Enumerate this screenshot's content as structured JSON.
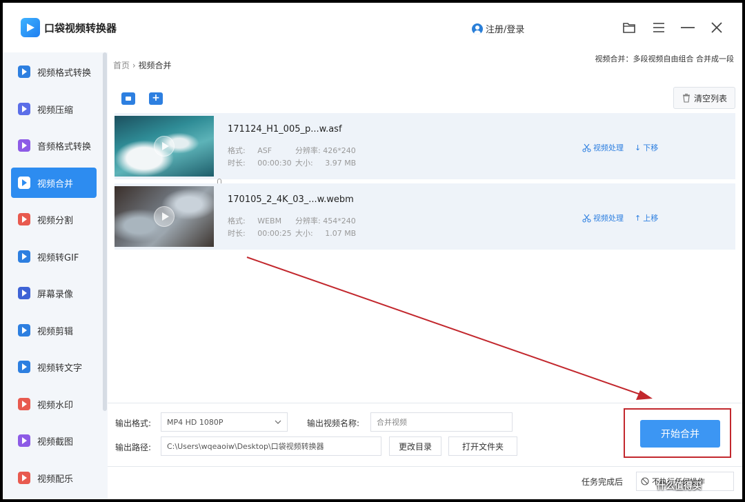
{
  "app": {
    "title": "口袋视频转换器",
    "login": "注册/登录"
  },
  "sidebar": {
    "items": [
      {
        "label": "视频格式转换",
        "color": "#2d7fe0"
      },
      {
        "label": "视频压缩",
        "color": "#5b6ee8"
      },
      {
        "label": "音频格式转换",
        "color": "#8d5be6"
      },
      {
        "label": "视频合并",
        "color": "#2d8cf0"
      },
      {
        "label": "视频分割",
        "color": "#e85a4f"
      },
      {
        "label": "视频转GIF",
        "color": "#2d7fe0"
      },
      {
        "label": "屏幕录像",
        "color": "#3e63d6"
      },
      {
        "label": "视频剪辑",
        "color": "#2d7fe0"
      },
      {
        "label": "视频转文字",
        "color": "#2d7fe0"
      },
      {
        "label": "视频水印",
        "color": "#e85a4f"
      },
      {
        "label": "视频截图",
        "color": "#8d5be6"
      },
      {
        "label": "视频配乐",
        "color": "#e85a4f"
      }
    ],
    "active_index": 3
  },
  "breadcrumb": {
    "home": "首页",
    "sep": "›",
    "current": "视频合并"
  },
  "hint": "视频合并：多段视频自由组合 合并成一段",
  "toolbar": {
    "clear_label": "清空列表"
  },
  "labels": {
    "format": "格式:",
    "resolution": "分辨率:",
    "duration": "时长:",
    "size": "大小:"
  },
  "videos": [
    {
      "name": "171124_H1_005_p...w.asf",
      "format": "ASF",
      "resolution": "426*240",
      "duration": "00:00:30",
      "size": "3.97 MB",
      "process": "视频处理",
      "move": "下移",
      "move_glyph": "↓"
    },
    {
      "name": "170105_2_4K_03_...w.webm",
      "format": "WEBM",
      "resolution": "454*240",
      "duration": "00:00:25",
      "size": "1.07 MB",
      "process": "视频处理",
      "move": "上移",
      "move_glyph": "↑"
    }
  ],
  "output": {
    "format_label": "输出格式:",
    "format_value": "MP4   HD 1080P",
    "name_label": "输出视频名称:",
    "name_placeholder": "合并视频",
    "path_label": "输出路径:",
    "path_value": "C:\\Users\\wqeaoiw\\Desktop\\口袋视频转换器",
    "change_dir": "更改目录",
    "open_folder": "打开文件夹"
  },
  "start_button": "开始合并",
  "after_task": {
    "label": "任务完成后",
    "value": "不执行任何操作"
  },
  "watermark": "什么值得买",
  "colors": {
    "accent": "#2d8cf0",
    "annotation_red": "#c2272d"
  }
}
